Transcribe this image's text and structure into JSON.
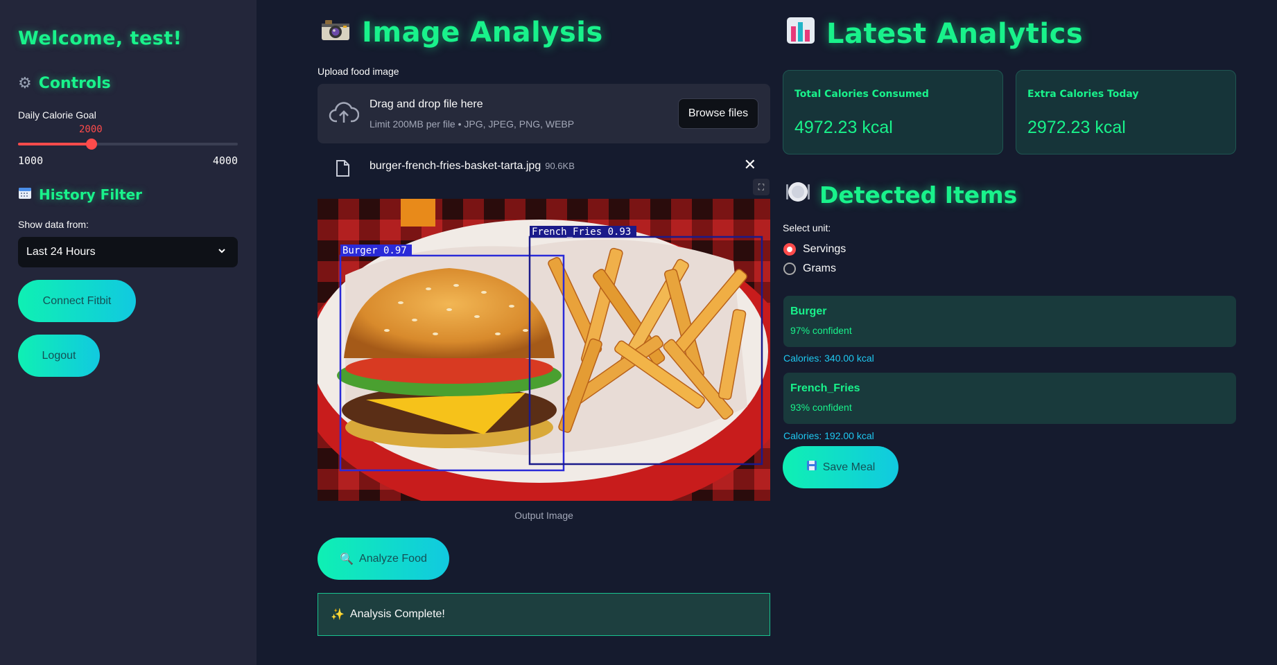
{
  "sidebar": {
    "welcome": "Welcome, test!",
    "controls_title": "Controls",
    "controls_icon": "gear-icon",
    "goal_label": "Daily Calorie Goal",
    "goal_value": "2000",
    "goal_min": "1000",
    "goal_max": "4000",
    "goal_numeric": 2000,
    "history_title": "History Filter",
    "history_icon": "calendar-icon",
    "show_label": "Show data from:",
    "filter_value": "Last 24 Hours",
    "connect_button": "Connect Fitbit",
    "logout_button": "Logout"
  },
  "analysis": {
    "title": "Image Analysis",
    "title_icon": "camera-icon",
    "upload_label": "Upload food image",
    "drop_title": "Drag and drop file here",
    "drop_limit": "Limit 200MB per file • JPG, JPEG, PNG, WEBP",
    "browse_button": "Browse files",
    "file_name": "burger-french-fries-basket-tarta.jpg",
    "file_size": "90.6KB",
    "detections": [
      {
        "label": "Burger 0.97"
      },
      {
        "label": "French_Fries 0.93"
      }
    ],
    "output_caption": "Output Image",
    "analyze_button": "Analyze Food",
    "analyze_icon": "magnifier-icon",
    "success_text": "Analysis Complete!",
    "success_icon": "sparkles-icon"
  },
  "analytics": {
    "title": "Latest Analytics",
    "title_icon": "bar-chart-icon",
    "metrics": [
      {
        "label": "Total Calories Consumed",
        "value": "4972.23 kcal"
      },
      {
        "label": "Extra Calories Today",
        "value": "2972.23 kcal"
      }
    ]
  },
  "detected": {
    "title": "Detected Items",
    "title_icon": "plate-icon",
    "unit_label": "Select unit:",
    "units": [
      "Servings",
      "Grams"
    ],
    "selected_unit": "Servings",
    "items": [
      {
        "name": "Burger",
        "confidence": "97% confident",
        "calories": "Calories: 340.00 kcal"
      },
      {
        "name": "French_Fries",
        "confidence": "93% confident",
        "calories": "Calories: 192.00 kcal"
      }
    ],
    "save_button": "Save Meal",
    "save_icon": "save-icon"
  },
  "colors": {
    "accent": "#19f28b",
    "slider": "#ff4b4b",
    "button_gradient_start": "#0ff0b3",
    "button_gradient_end": "#11c9e0",
    "calories_text": "#1ec8f0"
  }
}
